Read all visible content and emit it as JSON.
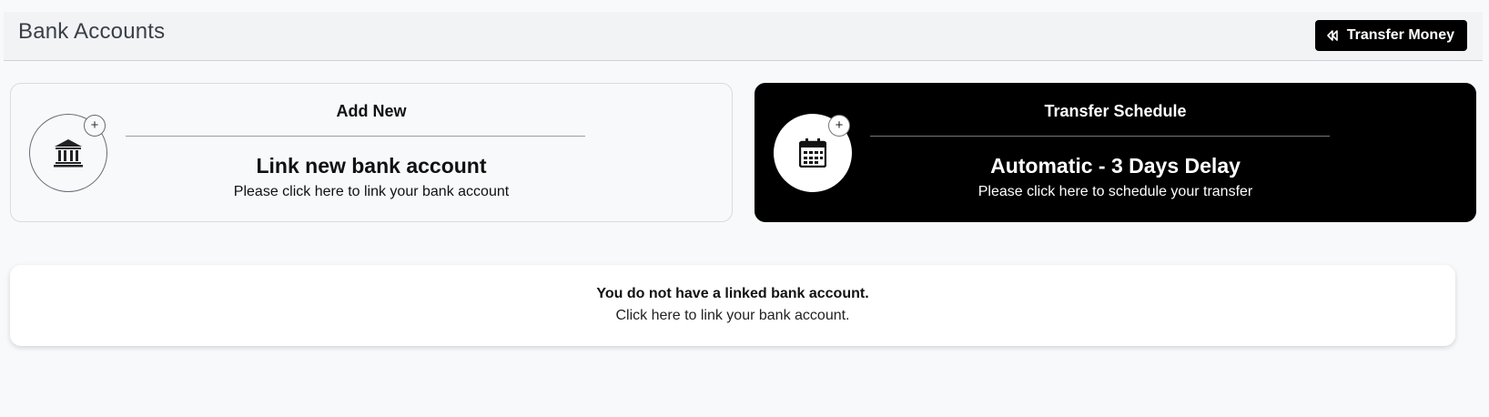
{
  "header": {
    "title": "Bank Accounts",
    "transfer_button": {
      "label": "Transfer Money",
      "icon": "rewind-icon"
    }
  },
  "cards": {
    "add_new": {
      "heading": "Add New",
      "main": "Link new bank account",
      "sub": "Please click here to link your bank account",
      "icon": "bank-icon",
      "badge": "+"
    },
    "transfer_schedule": {
      "heading": "Transfer Schedule",
      "main": "Automatic - 3 Days Delay",
      "sub": "Please click here to schedule your transfer",
      "icon": "calendar-icon",
      "badge": "+"
    }
  },
  "notice": {
    "title": "You do not have a linked bank account.",
    "sub": "Click here to link your bank account."
  },
  "colors": {
    "background": "#f8f9fb",
    "header_bg": "#f2f3f5",
    "accent_dark": "#000000",
    "text_on_dark": "#ffffff"
  }
}
